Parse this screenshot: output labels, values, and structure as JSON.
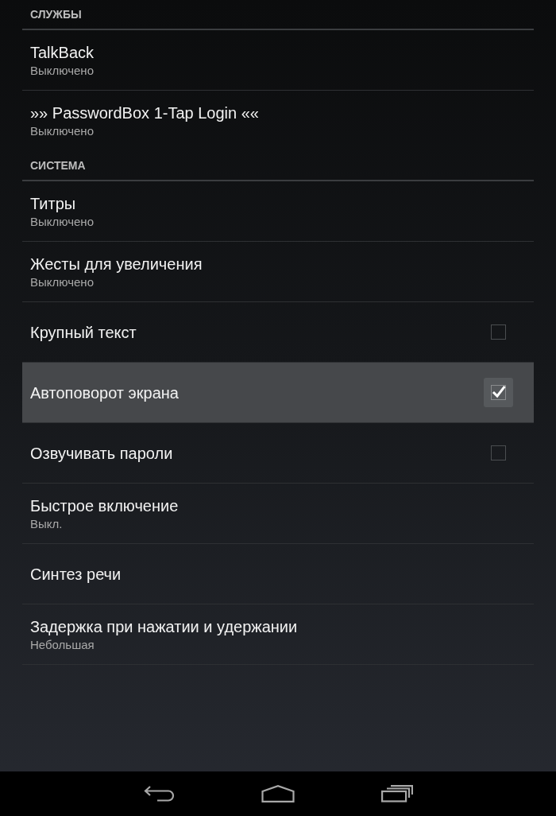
{
  "sections": [
    {
      "title": "СЛУЖБЫ",
      "items": [
        {
          "kind": "summary",
          "title": "TalkBack",
          "summary": "Выключено",
          "selected": false
        },
        {
          "kind": "summary",
          "title": "»» PasswordBox 1-Tap Login ««",
          "summary": "Выключено",
          "selected": false
        }
      ]
    },
    {
      "title": "СИСТЕМА",
      "items": [
        {
          "kind": "summary",
          "title": "Титры",
          "summary": "Выключено",
          "selected": false
        },
        {
          "kind": "summary",
          "title": "Жесты для увеличения",
          "summary": "Выключено",
          "selected": false
        },
        {
          "kind": "checkbox",
          "title": "Крупный текст",
          "checked": false,
          "selected": false
        },
        {
          "kind": "checkbox",
          "title": "Автоповорот экрана",
          "checked": true,
          "selected": true
        },
        {
          "kind": "checkbox",
          "title": "Озвучивать пароли",
          "checked": false,
          "selected": false
        },
        {
          "kind": "summary",
          "title": "Быстрое включение",
          "summary": "Выкл.",
          "selected": false
        },
        {
          "kind": "plain",
          "title": "Синтез речи",
          "selected": false
        },
        {
          "kind": "summary",
          "title": "Задержка при нажатии и удержании",
          "summary": "Небольшая",
          "selected": false
        }
      ]
    }
  ]
}
